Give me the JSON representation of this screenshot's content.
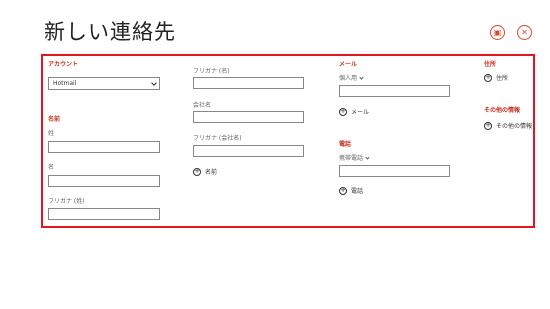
{
  "title": "新しい連絡先",
  "icons": {
    "save": "save-icon",
    "close": "close-icon"
  },
  "colors": {
    "accent": "#d9472b",
    "highlight_frame": "#e2161c"
  },
  "account": {
    "label": "アカウント",
    "selected": "Hotmail"
  },
  "name_section": {
    "label": "名前",
    "last_name": "姓",
    "first_name": "名",
    "furigana_last": "フリガナ (姓)"
  },
  "column2": {
    "furigana_first": "フリガナ (名)",
    "company": "会社名",
    "furigana_company": "フリガナ (会社名)",
    "add_name": "名前"
  },
  "email_section": {
    "label": "メール",
    "type": "個人用",
    "add": "メール"
  },
  "phone_section": {
    "label": "電話",
    "type": "携帯電話",
    "add": "電話"
  },
  "address_section": {
    "label": "住所",
    "add": "住所"
  },
  "other_section": {
    "label": "その他の情報",
    "add": "その他の情報"
  }
}
